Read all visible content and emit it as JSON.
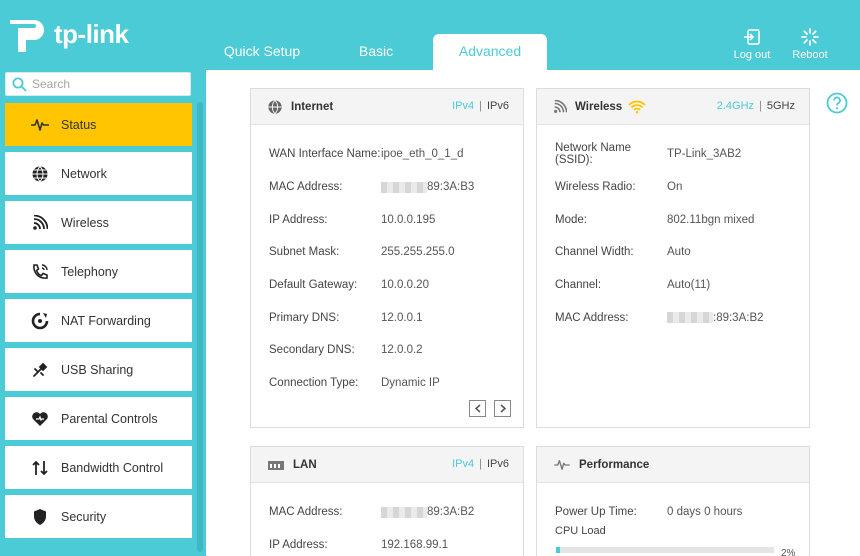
{
  "header": {
    "logo_text": "tp-link",
    "tabs": [
      {
        "label": "Quick Setup"
      },
      {
        "label": "Basic"
      },
      {
        "label": "Advanced"
      }
    ],
    "logout_label": "Log out",
    "reboot_label": "Reboot"
  },
  "search": {
    "placeholder": "Search"
  },
  "sidebar": {
    "items": [
      {
        "label": "Status",
        "icon": "pulse-icon",
        "active": true
      },
      {
        "label": "Network",
        "icon": "globe-icon"
      },
      {
        "label": "Wireless",
        "icon": "wifi-icon"
      },
      {
        "label": "Telephony",
        "icon": "phone-icon"
      },
      {
        "label": "NAT Forwarding",
        "icon": "nat-icon"
      },
      {
        "label": "USB Sharing",
        "icon": "usb-icon"
      },
      {
        "label": "Parental Controls",
        "icon": "heart-icon"
      },
      {
        "label": "Bandwidth Control",
        "icon": "updown-arrows-icon"
      },
      {
        "label": "Security",
        "icon": "shield-icon"
      }
    ]
  },
  "internet": {
    "title": "Internet",
    "ipv4": "IPv4",
    "sep": "|",
    "ipv6": "IPv6",
    "rows": [
      {
        "label": "WAN Interface Name:",
        "value": "ipoe_eth_0_1_d"
      },
      {
        "label": "MAC Address:",
        "value": "89:3A:B3",
        "masked": true
      },
      {
        "label": "IP Address:",
        "value": "10.0.0.195"
      },
      {
        "label": "Subnet Mask:",
        "value": "255.255.255.0"
      },
      {
        "label": "Default Gateway:",
        "value": "10.0.0.20"
      },
      {
        "label": "Primary DNS:",
        "value": "12.0.0.1"
      },
      {
        "label": "Secondary DNS:",
        "value": "12.0.0.2"
      },
      {
        "label": "Connection Type:",
        "value": "Dynamic IP"
      }
    ]
  },
  "wireless": {
    "title": "Wireless",
    "band24": "2.4GHz",
    "sep": "|",
    "band5": "5GHz",
    "rows": [
      {
        "label": "Network Name (SSID):",
        "value": "TP-Link_3AB2"
      },
      {
        "label": "Wireless Radio:",
        "value": "On"
      },
      {
        "label": "Mode:",
        "value": "802.11bgn mixed"
      },
      {
        "label": "Channel Width:",
        "value": "Auto"
      },
      {
        "label": "Channel:",
        "value": "Auto(11)"
      },
      {
        "label": "MAC Address:",
        "value": ":89:3A:B2",
        "masked": true
      }
    ]
  },
  "lan": {
    "title": "LAN",
    "ipv4": "IPv4",
    "sep": "|",
    "ipv6": "IPv6",
    "rows": [
      {
        "label": "MAC Address:",
        "value": "89:3A:B2",
        "masked": true
      },
      {
        "label": "IP Address:",
        "value": "192.168.99.1"
      }
    ]
  },
  "performance": {
    "title": "Performance",
    "power_up_label": "Power Up Time:",
    "power_up_value": "0 days 0 hours",
    "cpu_label": "CPU Load",
    "cpu_load_fraction": 0.02,
    "cpu_pct": "2%"
  },
  "colors": {
    "accent": "#4acbd6",
    "active_menu": "#ffc501",
    "wifi_icon": "#ffc501"
  }
}
